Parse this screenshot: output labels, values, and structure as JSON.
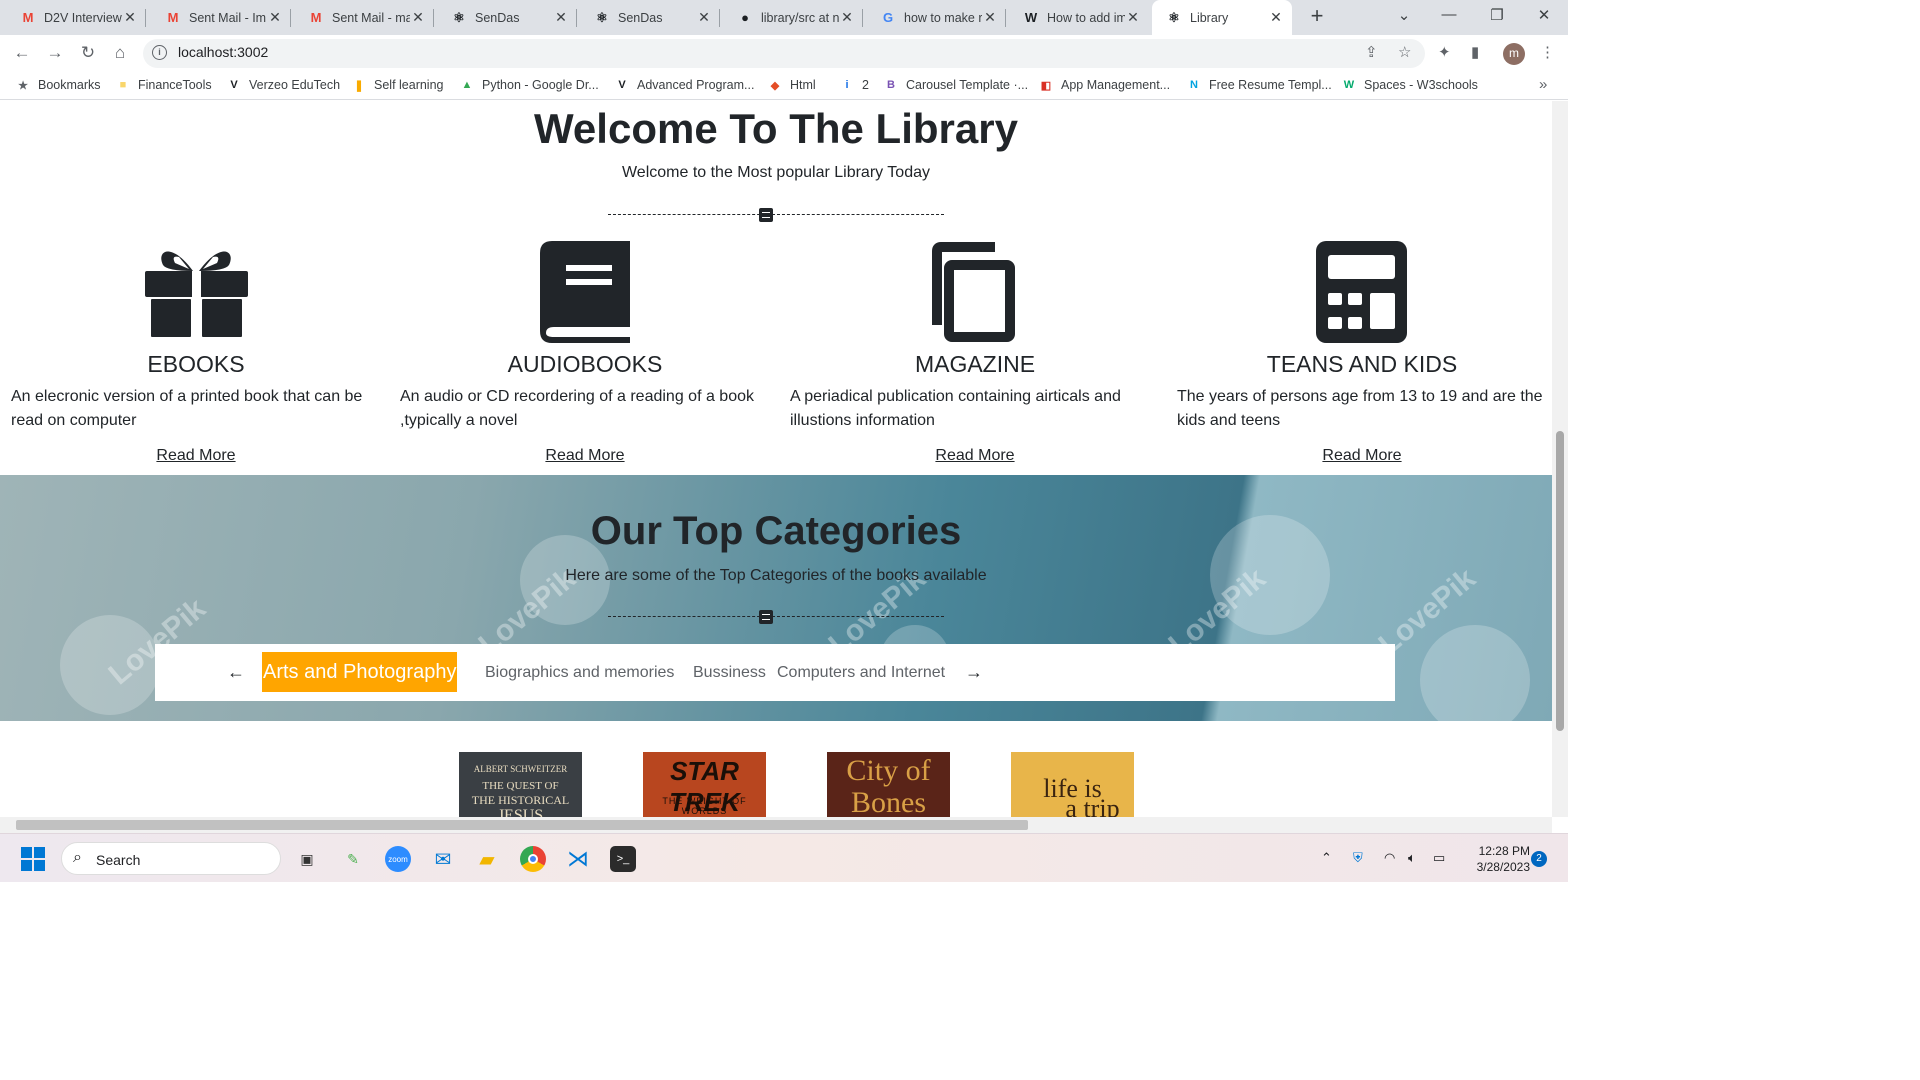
{
  "browser": {
    "tabs": [
      {
        "title": "D2V Interview",
        "icon": "gmail-icon",
        "glyph": "M",
        "color": "#ea4335"
      },
      {
        "title": "Sent Mail - Im",
        "icon": "gmail-icon",
        "glyph": "M",
        "color": "#ea4335"
      },
      {
        "title": "Sent Mail - ma",
        "icon": "gmail-icon",
        "glyph": "M",
        "color": "#ea4335"
      },
      {
        "title": "SenDas",
        "icon": "react-icon",
        "glyph": "⚛",
        "color": "#1b1f23"
      },
      {
        "title": "SenDas",
        "icon": "react-icon",
        "glyph": "⚛",
        "color": "#1b1f23"
      },
      {
        "title": "library/src at n",
        "icon": "github-icon",
        "glyph": "●",
        "color": "#1b1f23"
      },
      {
        "title": "how to make r",
        "icon": "google-icon",
        "glyph": "G",
        "color": "#4285f4"
      },
      {
        "title": "How to add im",
        "icon": "wikipedia-icon",
        "glyph": "W",
        "color": "#1b1f23"
      },
      {
        "title": "Library",
        "icon": "react-icon",
        "glyph": "⚛",
        "color": "#1b1f23",
        "active": true
      }
    ],
    "url": "localhost:3002",
    "profile_initial": "m",
    "bookmarks": [
      {
        "label": "Bookmarks",
        "icon": "star-icon",
        "glyph": "★",
        "color": "#5f6368"
      },
      {
        "label": "FinanceTools",
        "icon": "folder-icon",
        "glyph": "■",
        "color": "#f9d66b"
      },
      {
        "label": "Verzeo EduTech",
        "icon": "verzeo-icon",
        "glyph": "V",
        "color": "#1b1f23"
      },
      {
        "label": "Self learning",
        "icon": "bars-icon",
        "glyph": "❚",
        "color": "#f9ab00"
      },
      {
        "label": "Python - Google Dr...",
        "icon": "drive-icon",
        "glyph": "▲",
        "color": "#34a853"
      },
      {
        "label": "Advanced Program...",
        "icon": "verzeo-icon",
        "glyph": "V",
        "color": "#1b1f23"
      },
      {
        "label": "Html",
        "icon": "html-icon",
        "glyph": "◆",
        "color": "#e44d26"
      },
      {
        "label": "2",
        "icon": "info-icon",
        "glyph": "i",
        "color": "#1a73e8"
      },
      {
        "label": "Carousel Template ·...",
        "icon": "bootstrap-icon",
        "glyph": "B",
        "color": "#7952b3"
      },
      {
        "label": "App Management...",
        "icon": "app-icon",
        "glyph": "◧",
        "color": "#d93025"
      },
      {
        "label": "Free Resume Templ...",
        "icon": "n-icon",
        "glyph": "N",
        "color": "#00a3e0"
      },
      {
        "label": "Spaces - W3schools",
        "icon": "w3-icon",
        "glyph": "W",
        "color": "#04aa6d"
      }
    ]
  },
  "page": {
    "welcome_title": "Welcome To The Library",
    "welcome_sub": "Welcome to the Most popular Library Today",
    "cards": [
      {
        "title": "EBOOKS",
        "desc": "An elecronic version of a printed book that can be read on computer",
        "link": "Read More",
        "icon": "gift-icon"
      },
      {
        "title": "AUDIOBOOKS",
        "desc": "An audio or CD recordering of a reading of a book ,typically a novel",
        "link": "Read More",
        "icon": "book-icon"
      },
      {
        "title": "MAGAZINE",
        "desc": "A periadical publication containing airticals and illustions information",
        "link": "Read More",
        "icon": "copy-icon"
      },
      {
        "title": "TEANS AND KIDS",
        "desc": "The years of persons age from 13 to 19 and are the kids and teens",
        "link": "Read More",
        "icon": "calculator-icon"
      }
    ],
    "categories_title": "Our Top Categories",
    "categories_sub": "Here are some of the Top Categories of the books available",
    "categories": [
      "Arts and Photography",
      "Biographics and memories",
      "Bussiness",
      "Computers and Internet"
    ],
    "watermark": "LovePik",
    "books": [
      {
        "lines": [
          "ALBERT SCHWEITZER",
          "THE QUEST OF",
          "THE HISTORICAL",
          "JESUS"
        ],
        "bg": "#3a3f44",
        "fg": "#e8dcc0"
      },
      {
        "lines": [
          "STAR TREK",
          "THE WEIGHT OF WORLDS"
        ],
        "bg": "#b8461f",
        "fg": "#1a0f08"
      },
      {
        "lines": [
          "City of",
          "Bones"
        ],
        "bg": "#5a2418",
        "fg": "#d9a046"
      },
      {
        "lines": [
          "life is",
          "a trip"
        ],
        "bg": "#e8b54a",
        "fg": "#3a2410"
      }
    ]
  },
  "taskbar": {
    "search_placeholder": "Search",
    "time": "12:28 PM",
    "date": "3/28/2023",
    "notifications": "2"
  }
}
